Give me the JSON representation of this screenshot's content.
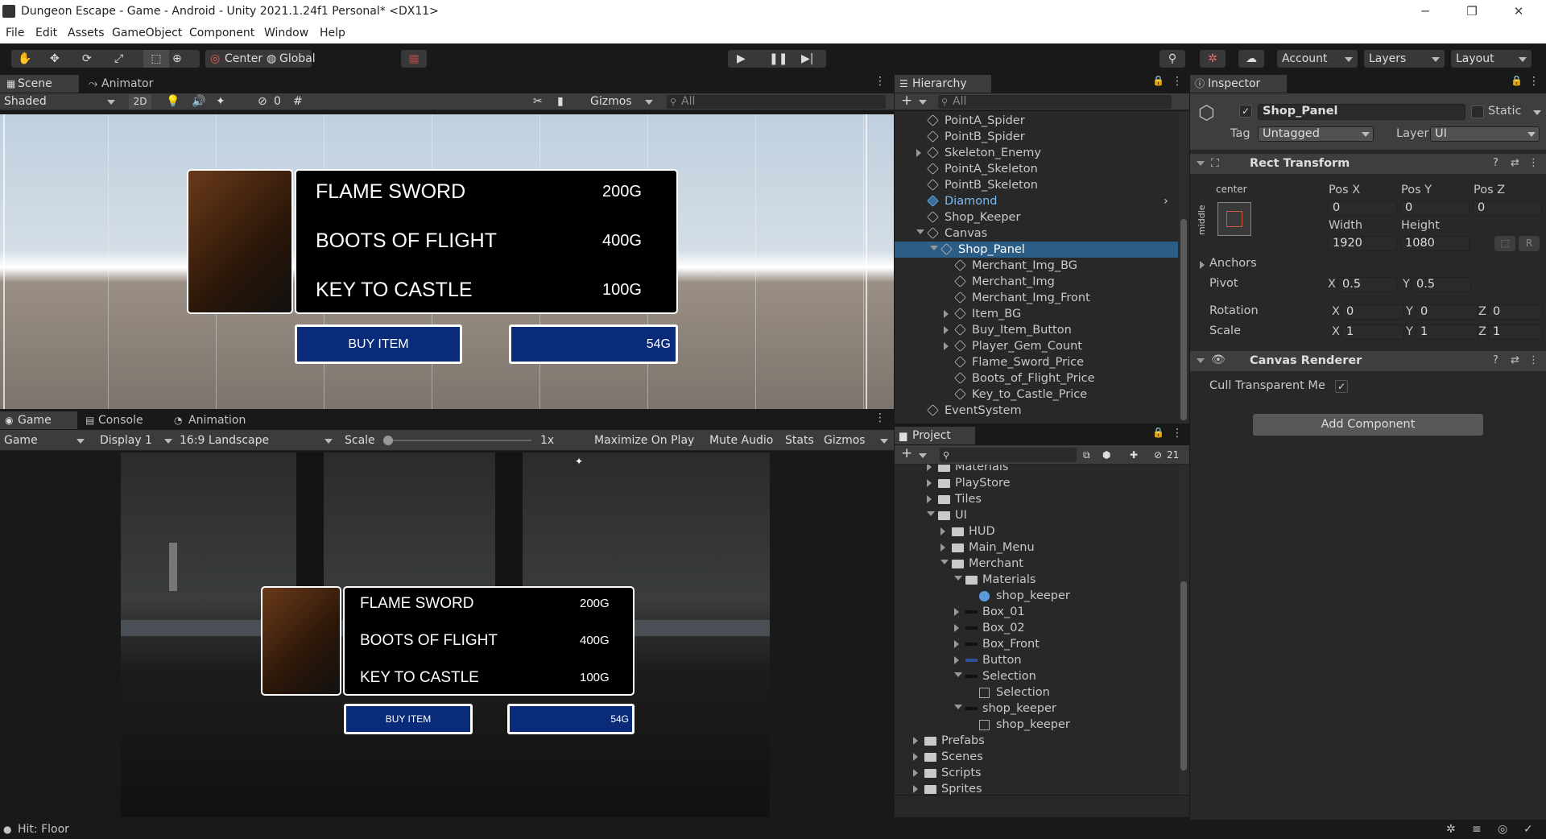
{
  "window": {
    "title": "Dungeon Escape - Game - Android - Unity 2021.1.24f1 Personal* <DX11>",
    "minimize": "─",
    "maximize": "❐",
    "close": "✕"
  },
  "menu": [
    "File",
    "Edit",
    "Assets",
    "GameObject",
    "Component",
    "Window",
    "Help"
  ],
  "toolbar": {
    "center": "Center",
    "global": "Global",
    "account": "Account",
    "layers": "Layers",
    "layout": "Layout"
  },
  "scene_tabs": {
    "scene": "Scene",
    "animator": "Animator"
  },
  "scene_bar": {
    "shading": "Shaded",
    "mode2d": "2D",
    "hidden_count": "0",
    "gizmos": "Gizmos",
    "search": "All"
  },
  "shop": {
    "items": [
      {
        "name": "FLAME SWORD",
        "price": "200G"
      },
      {
        "name": "BOOTS OF FLIGHT",
        "price": "400G"
      },
      {
        "name": "KEY TO CASTLE",
        "price": "100G"
      }
    ],
    "buy_label": "BUY ITEM",
    "gems": "54G"
  },
  "game_tabs": {
    "game": "Game",
    "console": "Console",
    "animation": "Animation"
  },
  "game_bar": {
    "view": "Game",
    "display": "Display 1",
    "aspect": "16:9 Landscape",
    "scale_label": "Scale",
    "scale_value": "1x",
    "maximize": "Maximize On Play",
    "mute": "Mute Audio",
    "stats": "Stats",
    "gizmos": "Gizmos"
  },
  "hierarchy": {
    "title": "Hierarchy",
    "search": "All",
    "rows": [
      {
        "label": "PointA_Spider",
        "depth": 1,
        "arrow": "none"
      },
      {
        "label": "PointB_Spider",
        "depth": 1,
        "arrow": "none"
      },
      {
        "label": "Skeleton_Enemy",
        "depth": 1,
        "arrow": "right"
      },
      {
        "label": "PointA_Skeleton",
        "depth": 1,
        "arrow": "none"
      },
      {
        "label": "PointB_Skeleton",
        "depth": 1,
        "arrow": "none"
      },
      {
        "label": "Diamond",
        "depth": 1,
        "arrow": "none",
        "prefab": true
      },
      {
        "label": "Shop_Keeper",
        "depth": 1,
        "arrow": "none"
      },
      {
        "label": "Canvas",
        "depth": 1,
        "arrow": "down"
      },
      {
        "label": "Shop_Panel",
        "depth": 2,
        "arrow": "down",
        "selected": true
      },
      {
        "label": "Merchant_Img_BG",
        "depth": 3,
        "arrow": "none"
      },
      {
        "label": "Merchant_Img",
        "depth": 3,
        "arrow": "none"
      },
      {
        "label": "Merchant_Img_Front",
        "depth": 3,
        "arrow": "none"
      },
      {
        "label": "Item_BG",
        "depth": 3,
        "arrow": "right"
      },
      {
        "label": "Buy_Item_Button",
        "depth": 3,
        "arrow": "right"
      },
      {
        "label": "Player_Gem_Count",
        "depth": 3,
        "arrow": "right"
      },
      {
        "label": "Flame_Sword_Price",
        "depth": 3,
        "arrow": "none"
      },
      {
        "label": "Boots_of_Flight_Price",
        "depth": 3,
        "arrow": "none"
      },
      {
        "label": "Key_to_Castle_Price",
        "depth": 3,
        "arrow": "none"
      },
      {
        "label": "EventSystem",
        "depth": 1,
        "arrow": "none"
      }
    ]
  },
  "project": {
    "title": "Project",
    "hidden_count": "21",
    "rows": [
      {
        "label": "Materials",
        "depth": 2,
        "kind": "folder",
        "arrow": "right"
      },
      {
        "label": "PlayStore",
        "depth": 2,
        "kind": "folder",
        "arrow": "right"
      },
      {
        "label": "Tiles",
        "depth": 2,
        "kind": "folder",
        "arrow": "right"
      },
      {
        "label": "UI",
        "depth": 2,
        "kind": "folder",
        "arrow": "down"
      },
      {
        "label": "HUD",
        "depth": 3,
        "kind": "folder",
        "arrow": "right"
      },
      {
        "label": "Main_Menu",
        "depth": 3,
        "kind": "folder",
        "arrow": "right"
      },
      {
        "label": "Merchant",
        "depth": 3,
        "kind": "folder",
        "arrow": "down"
      },
      {
        "label": "Materials",
        "depth": 4,
        "kind": "folder",
        "arrow": "down"
      },
      {
        "label": "shop_keeper",
        "depth": 5,
        "kind": "material",
        "arrow": "none"
      },
      {
        "label": "Box_01",
        "depth": 4,
        "kind": "sprite",
        "arrow": "right"
      },
      {
        "label": "Box_02",
        "depth": 4,
        "kind": "sprite",
        "arrow": "right"
      },
      {
        "label": "Box_Front",
        "depth": 4,
        "kind": "sprite",
        "arrow": "right"
      },
      {
        "label": "Button",
        "depth": 4,
        "kind": "sprite",
        "arrow": "right"
      },
      {
        "label": "Selection",
        "depth": 4,
        "kind": "sprite",
        "arrow": "down"
      },
      {
        "label": "Selection",
        "depth": 5,
        "kind": "subsprite",
        "arrow": "none"
      },
      {
        "label": "shop_keeper",
        "depth": 4,
        "kind": "sprite",
        "arrow": "down"
      },
      {
        "label": "shop_keeper",
        "depth": 5,
        "kind": "subsprite",
        "arrow": "none"
      },
      {
        "label": "Prefabs",
        "depth": 1,
        "kind": "folder",
        "arrow": "right"
      },
      {
        "label": "Scenes",
        "depth": 1,
        "kind": "folder",
        "arrow": "right"
      },
      {
        "label": "Scripts",
        "depth": 1,
        "kind": "folder",
        "arrow": "right"
      },
      {
        "label": "Sprites",
        "depth": 1,
        "kind": "folder",
        "arrow": "right"
      }
    ]
  },
  "inspector": {
    "title": "Inspector",
    "object_name": "Shop_Panel",
    "static": "Static",
    "tag_label": "Tag",
    "tag": "Untagged",
    "layer_label": "Layer",
    "layer": "UI",
    "rect": {
      "title": "Rect Transform",
      "anchor_h": "center",
      "anchor_v": "middle",
      "posx_l": "Pos X",
      "posy_l": "Pos Y",
      "posz_l": "Pos Z",
      "posx": "0",
      "posy": "0",
      "posz": "0",
      "width_l": "Width",
      "height_l": "Height",
      "width": "1920",
      "height": "1080",
      "r_btn": "R",
      "anchors": "Anchors",
      "pivot": "Pivot",
      "pivot_x": "0.5",
      "pivot_y": "0.5",
      "rotation": "Rotation",
      "rot_x": "0",
      "rot_y": "0",
      "rot_z": "0",
      "scale": "Scale",
      "scale_x": "1",
      "scale_y": "1",
      "scale_z": "1",
      "x": "X",
      "y": "Y",
      "z": "Z"
    },
    "canvas_renderer": {
      "title": "Canvas Renderer",
      "cull": "Cull Transparent Me"
    },
    "add_component": "Add Component"
  },
  "status": {
    "text": "Hit: Floor"
  }
}
